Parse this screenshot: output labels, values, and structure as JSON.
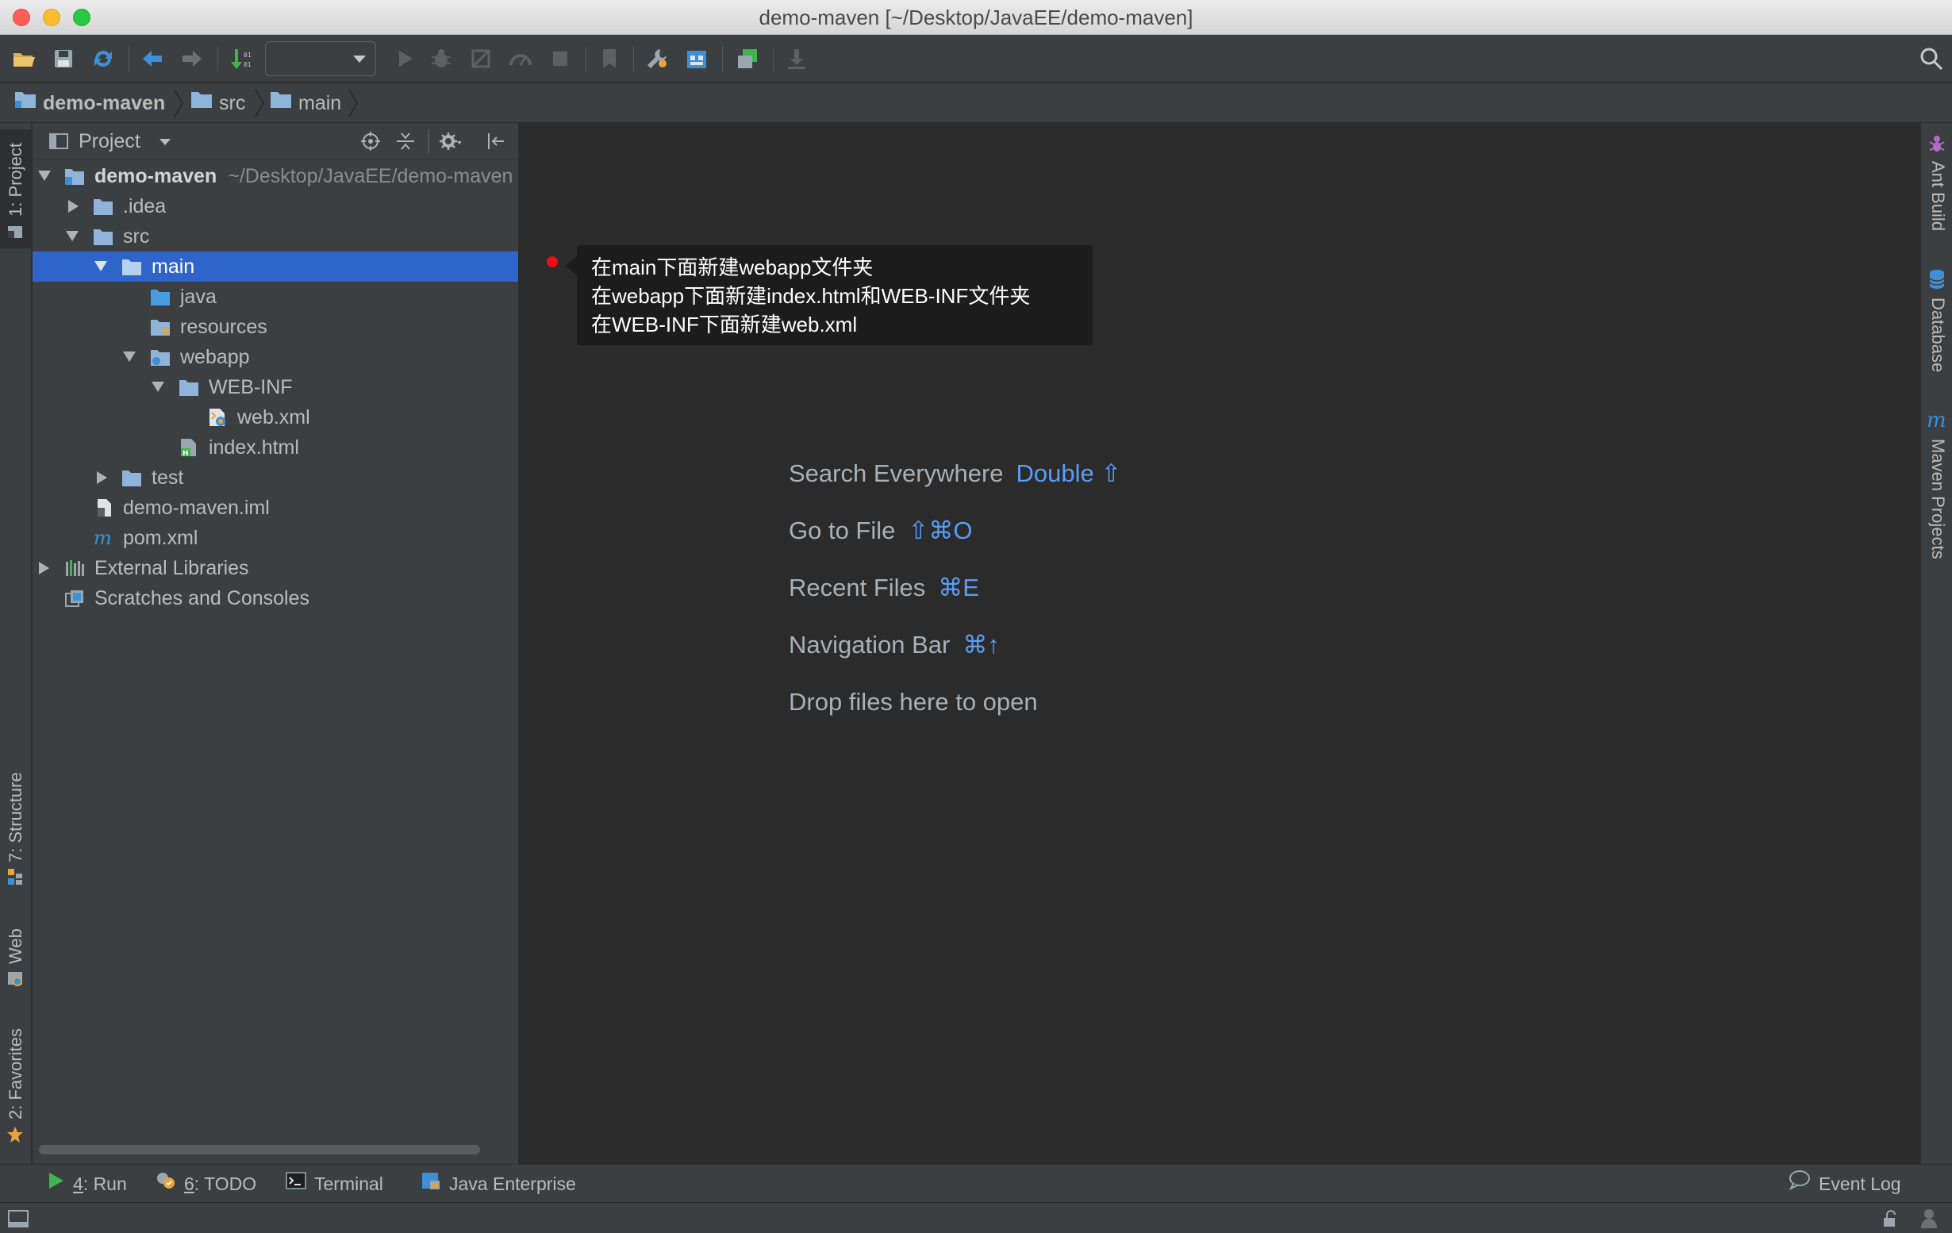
{
  "window": {
    "title": "demo-maven [~/Desktop/JavaEE/demo-maven]"
  },
  "toolbar": {
    "run_config_value": "",
    "icons": [
      "open-folder-icon",
      "save-icon",
      "sync-icon",
      "back-icon",
      "forward-icon",
      "vcs-update-icon",
      "run-icon",
      "debug-icon",
      "coverage-icon",
      "profile-icon",
      "stop-icon",
      "bookmark-icon",
      "settings-wrench-icon",
      "project-structure-icon",
      "sdk-icon",
      "download-icon",
      "search-icon"
    ]
  },
  "breadcrumb": {
    "items": [
      "demo-maven",
      "src",
      "main"
    ]
  },
  "left_stripe": {
    "tabs": [
      "1: Project",
      "7: Structure",
      "Web",
      "2: Favorites"
    ]
  },
  "project_panel": {
    "title": "Project",
    "tree": [
      {
        "label": "demo-maven",
        "path": "~/Desktop/JavaEE/demo-maven",
        "icon": "module-folder-icon",
        "expanded": true
      },
      {
        "label": ".idea",
        "icon": "folder-icon",
        "expanded": false
      },
      {
        "label": "src",
        "icon": "folder-icon",
        "expanded": true
      },
      {
        "label": "main",
        "icon": "folder-icon",
        "expanded": true,
        "selected": true
      },
      {
        "label": "java",
        "icon": "source-folder-icon"
      },
      {
        "label": "resources",
        "icon": "resources-folder-icon"
      },
      {
        "label": "webapp",
        "icon": "web-folder-icon",
        "expanded": true
      },
      {
        "label": "WEB-INF",
        "icon": "folder-icon",
        "expanded": true
      },
      {
        "label": "web.xml",
        "icon": "xml-file-icon"
      },
      {
        "label": "index.html",
        "icon": "html-file-icon"
      },
      {
        "label": "test",
        "icon": "folder-icon",
        "expanded": false
      },
      {
        "label": "demo-maven.iml",
        "icon": "iml-file-icon"
      },
      {
        "label": "pom.xml",
        "icon": "maven-file-icon"
      },
      {
        "label": "External Libraries",
        "icon": "libraries-icon",
        "expanded": false
      },
      {
        "label": "Scratches and Consoles",
        "icon": "scratches-icon"
      }
    ]
  },
  "editor": {
    "tooltip_lines": [
      "在main下面新建webapp文件夹",
      "在webapp下面新建index.html和WEB-INF文件夹",
      "在WEB-INF下面新建web.xml"
    ],
    "hints": [
      {
        "label": "Search Everywhere",
        "shortcut": "Double ⇧"
      },
      {
        "label": "Go to File",
        "shortcut": "⇧⌘O"
      },
      {
        "label": "Recent Files",
        "shortcut": "⌘E"
      },
      {
        "label": "Navigation Bar",
        "shortcut": "⌘↑"
      },
      {
        "label": "Drop files here to open",
        "shortcut": ""
      }
    ]
  },
  "right_stripe": {
    "tabs": [
      "Ant Build",
      "Database",
      "Maven Projects"
    ]
  },
  "bottom_bar": {
    "run_key": "4",
    "run_label": ": Run",
    "todo_key": "6",
    "todo_label": ": TODO",
    "terminal": "Terminal",
    "java_enterprise": "Java Enterprise",
    "event_log": "Event Log"
  },
  "colors": {
    "selection": "#2f65ca",
    "shortcut": "#589df6",
    "folder": "#8fb3d9",
    "panel_bg": "#3c3f41",
    "editor_bg": "#2b2b2b"
  }
}
